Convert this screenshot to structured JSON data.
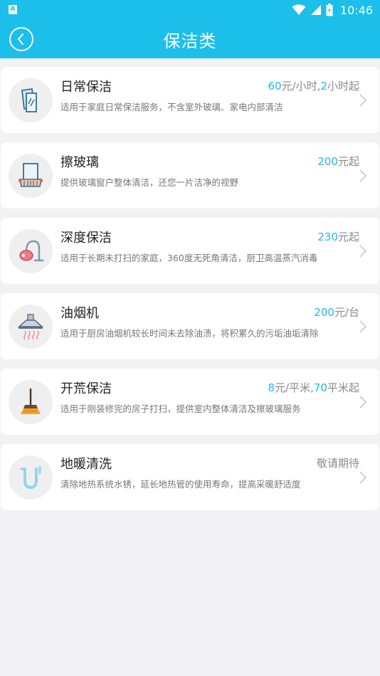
{
  "status_bar": {
    "app_badge": "A",
    "time": "10:46"
  },
  "header": {
    "title": "保洁类",
    "back_icon": "back-circle-icon"
  },
  "colors": {
    "primary": "#1cbfe9",
    "price_highlight": "#25b8e4",
    "background": "#f2f2f4"
  },
  "services": [
    {
      "title": "日常保洁",
      "desc": "适用于家庭日常保洁服务，不含室外玻璃、家电内部清洁",
      "icon": "glass-cleaning-icon",
      "price": [
        {
          "text": "60",
          "hl": true
        },
        {
          "text": "元/小时,",
          "hl": false
        },
        {
          "text": "2",
          "hl": true
        },
        {
          "text": "小时起",
          "hl": false
        }
      ]
    },
    {
      "title": "擦玻璃",
      "desc": "提供玻璃窗户整体清洁，还您一片洁净的视野",
      "icon": "window-icon",
      "price": [
        {
          "text": "200",
          "hl": true
        },
        {
          "text": "元起",
          "hl": false
        }
      ]
    },
    {
      "title": "深度保洁",
      "desc": "适用于长期未打扫的家庭，360度无死角清洁，厨卫高温蒸汽消毒",
      "icon": "vacuum-cleaner-icon",
      "price": [
        {
          "text": "230",
          "hl": true
        },
        {
          "text": "元起",
          "hl": false
        }
      ]
    },
    {
      "title": "油烟机",
      "desc": "适用于厨房油烟机较长时间未去除油渍，将积累久的污垢油垢清除",
      "icon": "range-hood-icon",
      "price": [
        {
          "text": "200",
          "hl": true
        },
        {
          "text": "元/台",
          "hl": false
        }
      ]
    },
    {
      "title": "开荒保洁",
      "desc": "适用于刚装修完的房子打扫，提供室内整体清洁及擦玻璃服务",
      "icon": "broom-icon",
      "price": [
        {
          "text": "8",
          "hl": true
        },
        {
          "text": "元/平米,",
          "hl": false
        },
        {
          "text": "70",
          "hl": true
        },
        {
          "text": "平米起",
          "hl": false
        }
      ]
    },
    {
      "title": "地暖清洗",
      "desc": "清除地热系统水锈，延长地热管的使用寿命，提高采暖舒适度",
      "icon": "floor-heating-pipe-icon",
      "price": [
        {
          "text": "敬请期待",
          "hl": false
        }
      ]
    }
  ]
}
